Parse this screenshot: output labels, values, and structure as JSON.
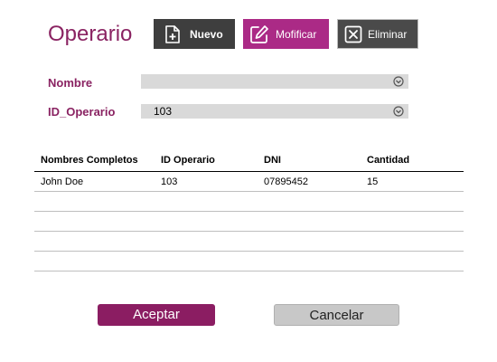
{
  "header": {
    "title": "Operario"
  },
  "toolbar": {
    "new_label": "Nuevo",
    "modify_label": "Mofificar",
    "delete_label": "Eliminar",
    "new_icon": "file-plus-icon",
    "modify_icon": "edit-icon",
    "delete_icon": "close-box-icon"
  },
  "form": {
    "nombre": {
      "label": "Nombre",
      "value": ""
    },
    "id_operario": {
      "label": "ID_Operario",
      "value": "103"
    },
    "dropdown_icon": "chevron-down-circle-icon"
  },
  "table": {
    "columns": [
      "Nombres Completos",
      "ID Operario",
      "DNI",
      "Cantidad"
    ],
    "rows": [
      [
        "John Doe",
        "103",
        "07895452",
        "15"
      ],
      [
        "",
        "",
        "",
        ""
      ],
      [
        "",
        "",
        "",
        ""
      ],
      [
        "",
        "",
        "",
        ""
      ],
      [
        "",
        "",
        "",
        ""
      ]
    ]
  },
  "actions": {
    "accept_label": "Aceptar",
    "cancel_label": "Cancelar"
  },
  "colors": {
    "accent": "#8a2362",
    "modify_button": "#ab2a86",
    "dark_button": "#3e3e3e",
    "field_bg": "#d9d9d9",
    "cancel_button": "#c8c8c8"
  }
}
